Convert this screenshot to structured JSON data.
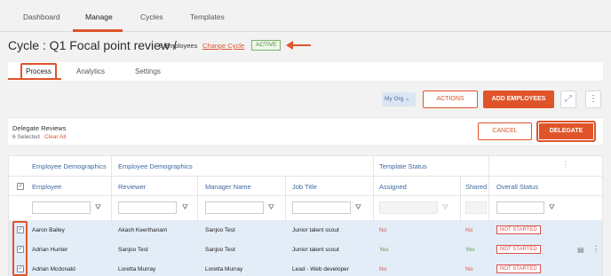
{
  "nav": {
    "tabs": [
      "Dashboard",
      "Manage",
      "Cycles",
      "Templates"
    ],
    "active": "Manage"
  },
  "cycle": {
    "title": "Cycle : Q1 Focal point review /",
    "employees": "8 Employees",
    "change_label": "Change Cycle",
    "status": "ACTIVE"
  },
  "subtabs": {
    "process": "Process",
    "analytics": "Analytics",
    "settings": "Settings"
  },
  "toolbar": {
    "org": "My Org",
    "actions": "ACTIONS",
    "add": "ADD EMPLOYEES"
  },
  "delegate": {
    "title": "Delegate Reviews",
    "selected": "6 Selected",
    "clear": "Clear All",
    "cancel": "CANCEL",
    "delegate": "DELEGATE"
  },
  "table": {
    "group_headers": [
      "Employee Demographics",
      "Employee Demographics",
      "Template Status"
    ],
    "columns": [
      "Employee",
      "Reviewer",
      "Manager Name",
      "Job Title",
      "Assigned",
      "Shared",
      "Overall Status"
    ],
    "rows": [
      {
        "employee": "Aaron Bailey",
        "reviewer": "Akash Keerthanam",
        "manager": "Sanjoo Test",
        "job": "Junior talent scout",
        "assigned": "No",
        "shared": "No",
        "status": "NOT STARTED"
      },
      {
        "employee": "Adrian Hunter",
        "reviewer": "Sanjoo Test",
        "manager": "Sanjoo Test",
        "job": "Junior talent scout",
        "assigned": "Yes",
        "shared": "Yes",
        "status": "NOT STARTED"
      },
      {
        "employee": "Adrian Mcdonald",
        "reviewer": "Loretta Murray",
        "manager": "Loretta Murray",
        "job": "Lead - Web developer",
        "assigned": "No",
        "shared": "No",
        "status": "NOT STARTED"
      }
    ]
  },
  "colors": {
    "accent": "#e0542a",
    "header_blue": "#3f6aa0",
    "row_selected": "#e3edf8",
    "active_green": "#4e8c3d"
  }
}
